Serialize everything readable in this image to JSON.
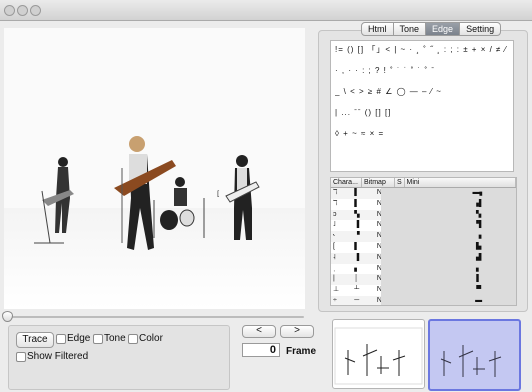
{
  "window": {
    "buttons": [
      "close-button",
      "minimize-button",
      "zoom-button"
    ]
  },
  "tabs": [
    {
      "label": "Html",
      "active": false
    },
    {
      "label": "Tone",
      "active": false
    },
    {
      "label": "Edge",
      "active": true
    },
    {
      "label": "Setting",
      "active": false
    }
  ],
  "controls": {
    "trace_label": "Trace",
    "edge_label": "Edge",
    "tone_label": "Tone",
    "color_label": "Color",
    "show_filtered_label": "Show Filtered",
    "prev_label": "<",
    "next_label": ">",
    "frame_value": "0",
    "frame_label": "Frame"
  },
  "glyphs": {
    "line1": "!= () [] 「」< | ~ · ¸ ˚ ˝ ¸ : ; : ± + × / ≠ ⁄",
    "line2": "· , · · : ; ? ! ˚ ˙ ˙ ˚ ˙ ˚ ˉ",
    "line3": "_ \\ < > ≥ # ∠ ◯ — – ⁄ ~",
    "line4": "| ... ˉˉ () [] []",
    "line5": "◊ + ~ ≈ × =",
    "list": [
      "!=",
      "()",
      "[]",
      "「」",
      "<",
      "|",
      "~",
      "·",
      "¸",
      "˚",
      "˝",
      "¸",
      ":",
      ";",
      ":",
      "±",
      "+",
      "×",
      "/",
      "≠",
      "⁄",
      "·",
      ",",
      "·",
      "·",
      ":",
      ";",
      "?",
      "!",
      "˚",
      "˙",
      "˙",
      "˚",
      "˙",
      "˚",
      "ˉ",
      "_",
      "\\",
      "<",
      ">",
      "≥",
      "#",
      "∠",
      "◯",
      "—",
      "–",
      "⁄",
      "~",
      "|",
      "...",
      "ˉˉ",
      "()",
      "[]",
      "[]",
      "◊",
      "+",
      "~",
      "≈",
      "×",
      "="
    ]
  },
  "table": {
    "headers": [
      "Chara...",
      "Bitmap",
      "S",
      "Mini"
    ],
    "rows": [
      {
        "char": "ℸ",
        "bitmap": "▌",
        "s": "N",
        "mini": "▬▖"
      },
      {
        "char": "ℸ",
        "bitmap": "▌",
        "s": "N",
        "mini": "▗▌"
      },
      {
        "char": "ↄ",
        "bitmap": "▚",
        "s": "N",
        "mini": "▝▖"
      },
      {
        "char": "˩",
        "bitmap": "▐",
        "s": "N",
        "mini": "▝▌"
      },
      {
        "char": "˞",
        "bitmap": "▝",
        "s": "N",
        "mini": "▗"
      },
      {
        "char": "[",
        "bitmap": "▌",
        "s": "N",
        "mini": "▙"
      },
      {
        "char": "˨",
        "bitmap": "▐",
        "s": "N",
        "mini": "▟"
      },
      {
        "char": "ˌ",
        "bitmap": "▖",
        "s": "N",
        "mini": "▖"
      },
      {
        "char": "|",
        "bitmap": "│",
        "s": "N",
        "mini": "▌"
      },
      {
        "char": "⊥",
        "bitmap": "┴",
        "s": "N",
        "mini": "▀"
      },
      {
        "char": "÷",
        "bitmap": "─",
        "s": "N",
        "mini": "▬"
      }
    ]
  }
}
